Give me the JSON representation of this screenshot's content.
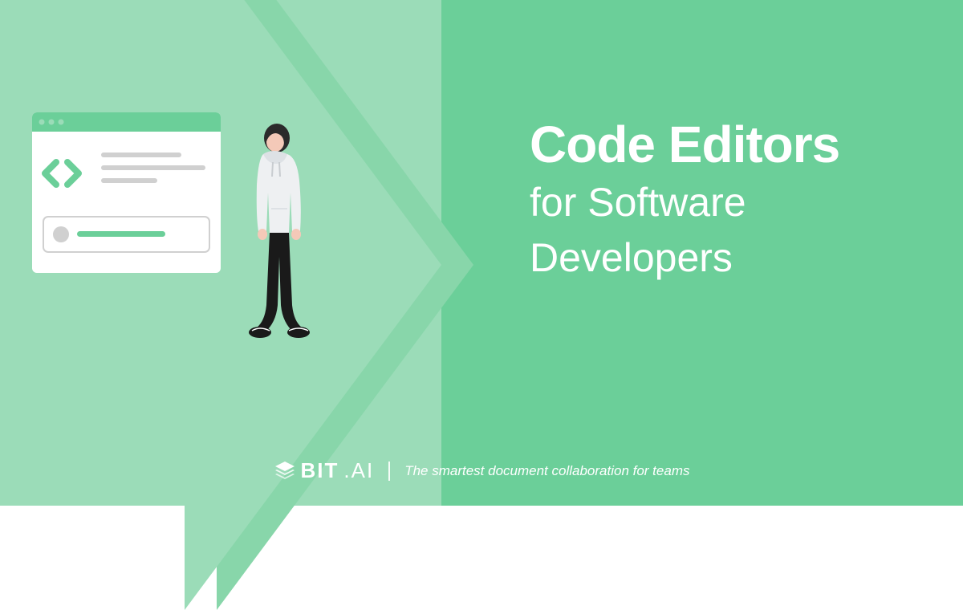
{
  "headline": {
    "bold": "Code Editors",
    "light1": "for Software",
    "light2": "Developers"
  },
  "brand": {
    "name": "BIT",
    "suffix": ".AI"
  },
  "tagline": "The smartest document collaboration for teams",
  "colors": {
    "bgMain": "#6bcf99",
    "bgLight": "#9bdcb8",
    "bgMid": "#88d6aa",
    "white": "#ffffff"
  }
}
